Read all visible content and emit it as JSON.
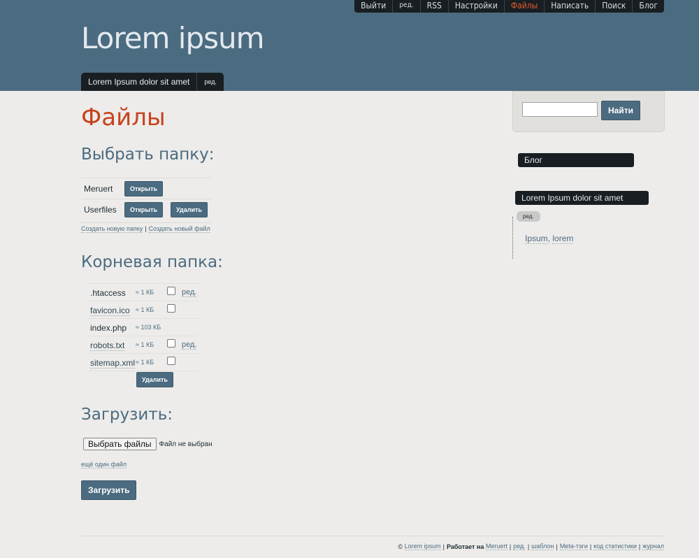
{
  "topnav": {
    "items": [
      {
        "label": "Выйти"
      },
      {
        "label": "ред."
      },
      {
        "label": "RSS"
      },
      {
        "label": "Настройки"
      },
      {
        "label": "Файлы"
      },
      {
        "label": "Написать"
      },
      {
        "label": "Поиск"
      },
      {
        "label": "Блог"
      }
    ],
    "active_color": "#e25a2c"
  },
  "site": {
    "title": "Lorem ipsum"
  },
  "page_tabs": {
    "title": "Lorem Ipsum dolor sit amet",
    "edit": "ред."
  },
  "page": {
    "title": "Файлы"
  },
  "folders": {
    "heading": "Выбрать папку:",
    "rows": [
      {
        "name": "Meruert",
        "open": "Открыть"
      },
      {
        "name": "Userfiles",
        "open": "Открыть",
        "delete": "Удалить"
      }
    ],
    "create_folder": "Создать новую папку",
    "separator": "|",
    "create_file": "Создать новый файл"
  },
  "root": {
    "heading": "Корневая папка:",
    "files": [
      {
        "name": ".htaccess",
        "size": "≈ 1 КБ",
        "edit": "ред."
      },
      {
        "name": "favicon.ico",
        "size": "≈ 1 КБ"
      },
      {
        "name": "index.php",
        "size": "≈ 103 КБ"
      },
      {
        "name": "robots.txt",
        "size": "≈ 1 КБ",
        "edit": "ред."
      },
      {
        "name": "sitemap.xml",
        "size": "≈ 1 КБ"
      }
    ],
    "delete": "Удалить"
  },
  "upload": {
    "heading": "Загрузить:",
    "choose": "Выбрать файлы",
    "status": "Файл не выбран",
    "more": "ещё один файл",
    "submit": "Загрузить"
  },
  "sidebar": {
    "search_button": "Найти",
    "blog": "Блог",
    "post_title": "Lorem Ipsum dolor sit amet",
    "edit": "ред.",
    "tag1": "Ipsum",
    "tag_sep": ",",
    "tag2": "lorem"
  },
  "footer": {
    "copy": "©",
    "site": "Lorem ipsum",
    "powered": "Работает на",
    "engine": "Meruert",
    "edit": "ред.",
    "template": "шаблон",
    "meta": "Meta-тэги",
    "stats": "код статистики",
    "journal": "журнал",
    "sep": "|"
  },
  "colors": {
    "header_bg": "#4b6b80",
    "nav_bg": "#181e22",
    "accent": "#c7431f",
    "button": "#4b6b80"
  }
}
